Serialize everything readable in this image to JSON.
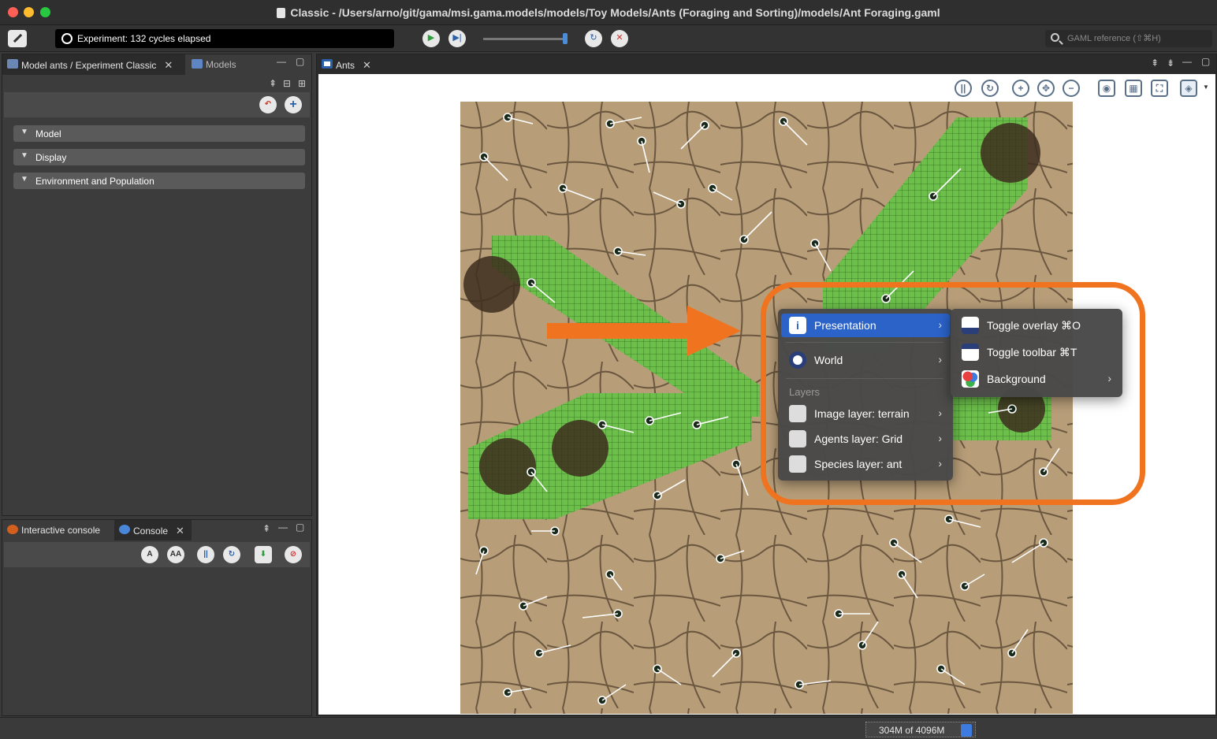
{
  "window": {
    "title": "Classic - /Users/arno/git/gama/msi.gama.models/models/Toy Models/Ants (Foraging and Sorting)/models/Ant Foraging.gaml"
  },
  "toolbar": {
    "experiment_status": "Experiment: 132 cycles elapsed",
    "search_placeholder": "GAML reference (⇧⌘H)"
  },
  "left_panel": {
    "tabs": [
      {
        "label": "Model ants / Experiment Classic",
        "active": true
      },
      {
        "label": "Models",
        "active": false
      }
    ],
    "sections": [
      "Model",
      "Display",
      "Environment and Population"
    ]
  },
  "console_panel": {
    "tabs": [
      {
        "label": "Interactive console",
        "active": false
      },
      {
        "label": "Console",
        "active": true
      }
    ]
  },
  "view": {
    "tab_label": "Ants"
  },
  "context_menu": {
    "items": [
      {
        "label": "Presentation",
        "highlighted": true
      },
      {
        "label": "World",
        "highlighted": false
      }
    ],
    "layers_header": "Layers",
    "layers": [
      {
        "label": "Image layer: terrain"
      },
      {
        "label": "Agents layer: Grid"
      },
      {
        "label": "Species layer: ant"
      }
    ]
  },
  "submenu": {
    "items": [
      {
        "label": "Toggle overlay ⌘O"
      },
      {
        "label": "Toggle toolbar ⌘T"
      },
      {
        "label": "Background"
      }
    ]
  },
  "statusbar": {
    "memory": "304M of 4096M"
  },
  "colors": {
    "highlight": "#2b63c9",
    "annotation": "#f07420",
    "pheromone": "#6cc04a",
    "terrain": "#b79d78"
  }
}
